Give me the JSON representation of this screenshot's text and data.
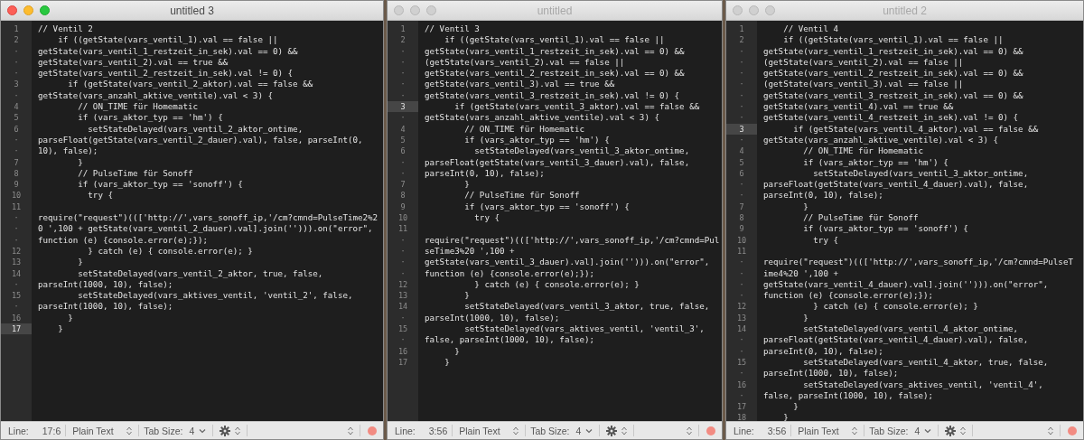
{
  "windows": [
    {
      "title": "untitled 3",
      "active": true,
      "lines": [
        {
          "num": "1",
          "text": "// Ventil 2",
          "current": false
        },
        {
          "num": "2",
          "text": "    if ((getState(vars_ventil_1).val == false ||",
          "current": false
        },
        {
          "num": "·",
          "text": "getState(vars_ventil_1_restzeit_in_sek).val == 0) &&",
          "current": false
        },
        {
          "num": "·",
          "text": "getState(vars_ventil_2).val == true &&",
          "current": false
        },
        {
          "num": "·",
          "text": "getState(vars_ventil_2_restzeit_in_sek).val != 0) {",
          "current": false
        },
        {
          "num": "3",
          "text": "      if (getState(vars_ventil_2_aktor).val == false &&",
          "current": false
        },
        {
          "num": "·",
          "text": "getState(vars_anzahl_aktive_ventile).val < 3) {",
          "current": false
        },
        {
          "num": "4",
          "text": "        // ON_TIME für Homematic",
          "current": false
        },
        {
          "num": "5",
          "text": "        if (vars_aktor_typ == 'hm') {",
          "current": false
        },
        {
          "num": "6",
          "text": "          setStateDelayed(vars_ventil_2_aktor_ontime,",
          "current": false
        },
        {
          "num": "·",
          "text": "parseFloat(getState(vars_ventil_2_dauer).val), false, parseInt(0,",
          "current": false
        },
        {
          "num": "·",
          "text": "10), false);",
          "current": false
        },
        {
          "num": "7",
          "text": "        }",
          "current": false
        },
        {
          "num": "8",
          "text": "        // PulseTime für Sonoff",
          "current": false
        },
        {
          "num": "9",
          "text": "        if (vars_aktor_typ == 'sonoff') {",
          "current": false
        },
        {
          "num": "10",
          "text": "          try {",
          "current": false
        },
        {
          "num": "11",
          "current": false
        },
        {
          "num": "·",
          "text": "require(\"request\")((['http://',vars_sonoff_ip,'/cm?cmnd=PulseTime2%2",
          "current": false
        },
        {
          "num": "·",
          "text": "0 ',100 + getState(vars_ventil_2_dauer).val].join(''))).on(\"error\",",
          "current": false
        },
        {
          "num": "·",
          "text": "function (e) {console.error(e);});",
          "current": false
        },
        {
          "num": "12",
          "text": "          } catch (e) { console.error(e); }",
          "current": false
        },
        {
          "num": "13",
          "text": "        }",
          "current": false
        },
        {
          "num": "14",
          "text": "        setStateDelayed(vars_ventil_2_aktor, true, false,",
          "current": false
        },
        {
          "num": "·",
          "text": "parseInt(1000, 10), false);",
          "current": false
        },
        {
          "num": "15",
          "text": "        setStateDelayed(vars_aktives_ventil, 'ventil_2', false,",
          "current": false
        },
        {
          "num": "·",
          "text": "parseInt(1000, 10), false);",
          "current": false
        },
        {
          "num": "16",
          "text": "      }",
          "current": false
        },
        {
          "num": "17",
          "text": "    }",
          "current": true
        }
      ],
      "status": {
        "line_label": "Line:",
        "position": "17:6",
        "syntax": "Plain Text",
        "tab_label": "Tab Size:",
        "tab_size": "4"
      }
    },
    {
      "title": "untitled",
      "active": false,
      "lines": [
        {
          "num": "1",
          "text": "// Ventil 3",
          "current": false
        },
        {
          "num": "2",
          "text": "    if ((getState(vars_ventil_1).val == false ||",
          "current": false
        },
        {
          "num": "·",
          "text": "getState(vars_ventil_1_restzeit_in_sek).val == 0) &&",
          "current": false
        },
        {
          "num": "·",
          "text": "(getState(vars_ventil_2).val == false ||",
          "current": false
        },
        {
          "num": "·",
          "text": "getState(vars_ventil_2_restzeit_in_sek).val == 0) &&",
          "current": false
        },
        {
          "num": "·",
          "text": "getState(vars_ventil_3).val == true &&",
          "current": false
        },
        {
          "num": "·",
          "text": "getState(vars_ventil_3_restzeit_in_sek).val != 0) {",
          "current": false
        },
        {
          "num": "3",
          "text": "      if (getState(vars_ventil_3_aktor).val == false &&",
          "current": true
        },
        {
          "num": "·",
          "text": "getState(vars_anzahl_aktive_ventile).val < 3) {",
          "current": false
        },
        {
          "num": "4",
          "text": "        // ON_TIME für Homematic",
          "current": false
        },
        {
          "num": "5",
          "text": "        if (vars_aktor_typ == 'hm') {",
          "current": false
        },
        {
          "num": "6",
          "text": "          setStateDelayed(vars_ventil_3_aktor_ontime,",
          "current": false
        },
        {
          "num": "·",
          "text": "parseFloat(getState(vars_ventil_3_dauer).val), false,",
          "current": false
        },
        {
          "num": "·",
          "text": "parseInt(0, 10), false);",
          "current": false
        },
        {
          "num": "7",
          "text": "        }",
          "current": false
        },
        {
          "num": "8",
          "text": "        // PulseTime für Sonoff",
          "current": false
        },
        {
          "num": "9",
          "text": "        if (vars_aktor_typ == 'sonoff') {",
          "current": false
        },
        {
          "num": "10",
          "text": "          try {",
          "current": false
        },
        {
          "num": "11",
          "current": false
        },
        {
          "num": "·",
          "text": "require(\"request\")((['http://',vars_sonoff_ip,'/cm?cmnd=Pul",
          "current": false
        },
        {
          "num": "·",
          "text": "seTime3%20 ',100 +",
          "current": false
        },
        {
          "num": "·",
          "text": "getState(vars_ventil_3_dauer).val].join(''))).on(\"error\",",
          "current": false
        },
        {
          "num": "·",
          "text": "function (e) {console.error(e);});",
          "current": false
        },
        {
          "num": "12",
          "text": "          } catch (e) { console.error(e); }",
          "current": false
        },
        {
          "num": "13",
          "text": "        }",
          "current": false
        },
        {
          "num": "14",
          "text": "        setStateDelayed(vars_ventil_3_aktor, true, false,",
          "current": false
        },
        {
          "num": "·",
          "text": "parseInt(1000, 10), false);",
          "current": false
        },
        {
          "num": "15",
          "text": "        setStateDelayed(vars_aktives_ventil, 'ventil_3',",
          "current": false
        },
        {
          "num": "·",
          "text": "false, parseInt(1000, 10), false);",
          "current": false
        },
        {
          "num": "16",
          "text": "      }",
          "current": false
        },
        {
          "num": "17",
          "text": "    }",
          "current": false
        }
      ],
      "status": {
        "line_label": "Line:",
        "position": "3:56",
        "syntax": "Plain Text",
        "tab_label": "Tab Size:",
        "tab_size": "4"
      }
    },
    {
      "title": "untitled 2",
      "active": false,
      "lines": [
        {
          "num": "1",
          "text": "    // Ventil 4",
          "current": false
        },
        {
          "num": "2",
          "text": "    if ((getState(vars_ventil_1).val == false ||",
          "current": false
        },
        {
          "num": "·",
          "text": "getState(vars_ventil_1_restzeit_in_sek).val == 0) &&",
          "current": false
        },
        {
          "num": "·",
          "text": "(getState(vars_ventil_2).val == false ||",
          "current": false
        },
        {
          "num": "·",
          "text": "getState(vars_ventil_2_restzeit_in_sek).val == 0) &&",
          "current": false
        },
        {
          "num": "·",
          "text": "(getState(vars_ventil_3).val == false ||",
          "current": false
        },
        {
          "num": "·",
          "text": "getState(vars_ventil_3_restzeit_in_sek).val == 0) &&",
          "current": false
        },
        {
          "num": "·",
          "text": "getState(vars_ventil_4).val == true &&",
          "current": false
        },
        {
          "num": "·",
          "text": "getState(vars_ventil_4_restzeit_in_sek).val != 0) {",
          "current": false
        },
        {
          "num": "3",
          "text": "      if (getState(vars_ventil_4_aktor).val == false &&",
          "current": true
        },
        {
          "num": "·",
          "text": "getState(vars_anzahl_aktive_ventile).val < 3) {",
          "current": false
        },
        {
          "num": "4",
          "text": "        // ON_TIME für Homematic",
          "current": false
        },
        {
          "num": "5",
          "text": "        if (vars_aktor_typ == 'hm') {",
          "current": false
        },
        {
          "num": "6",
          "text": "          setStateDelayed(vars_ventil_3_aktor_ontime,",
          "current": false
        },
        {
          "num": "·",
          "text": "parseFloat(getState(vars_ventil_4_dauer).val), false,",
          "current": false
        },
        {
          "num": "·",
          "text": "parseInt(0, 10), false);",
          "current": false
        },
        {
          "num": "7",
          "text": "        }",
          "current": false
        },
        {
          "num": "8",
          "text": "        // PulseTime für Sonoff",
          "current": false
        },
        {
          "num": "9",
          "text": "        if (vars_aktor_typ == 'sonoff') {",
          "current": false
        },
        {
          "num": "10",
          "text": "          try {",
          "current": false
        },
        {
          "num": "11",
          "current": false
        },
        {
          "num": "·",
          "text": "require(\"request\")((['http://',vars_sonoff_ip,'/cm?cmnd=PulseT",
          "current": false
        },
        {
          "num": "·",
          "text": "ime4%20 ',100 +",
          "current": false
        },
        {
          "num": "·",
          "text": "getState(vars_ventil_4_dauer).val].join(''))).on(\"error\",",
          "current": false
        },
        {
          "num": "·",
          "text": "function (e) {console.error(e);});",
          "current": false
        },
        {
          "num": "12",
          "text": "          } catch (e) { console.error(e); }",
          "current": false
        },
        {
          "num": "13",
          "text": "        }",
          "current": false
        },
        {
          "num": "14",
          "text": "        setStateDelayed(vars_ventil_4_aktor_ontime,",
          "current": false
        },
        {
          "num": "·",
          "text": "parseFloat(getState(vars_ventil_4_dauer).val), false,",
          "current": false
        },
        {
          "num": "·",
          "text": "parseInt(0, 10), false);",
          "current": false
        },
        {
          "num": "15",
          "text": "        setStateDelayed(vars_ventil_4_aktor, true, false,",
          "current": false
        },
        {
          "num": "·",
          "text": "parseInt(1000, 10), false);",
          "current": false
        },
        {
          "num": "16",
          "text": "        setStateDelayed(vars_aktives_ventil, 'ventil_4',",
          "current": false
        },
        {
          "num": "·",
          "text": "false, parseInt(1000, 10), false);",
          "current": false
        },
        {
          "num": "17",
          "text": "      }",
          "current": false
        },
        {
          "num": "18",
          "text": "    }",
          "current": false
        }
      ],
      "status": {
        "line_label": "Line:",
        "position": "3:56",
        "syntax": "Plain Text",
        "tab_label": "Tab Size:",
        "tab_size": "4"
      }
    }
  ]
}
